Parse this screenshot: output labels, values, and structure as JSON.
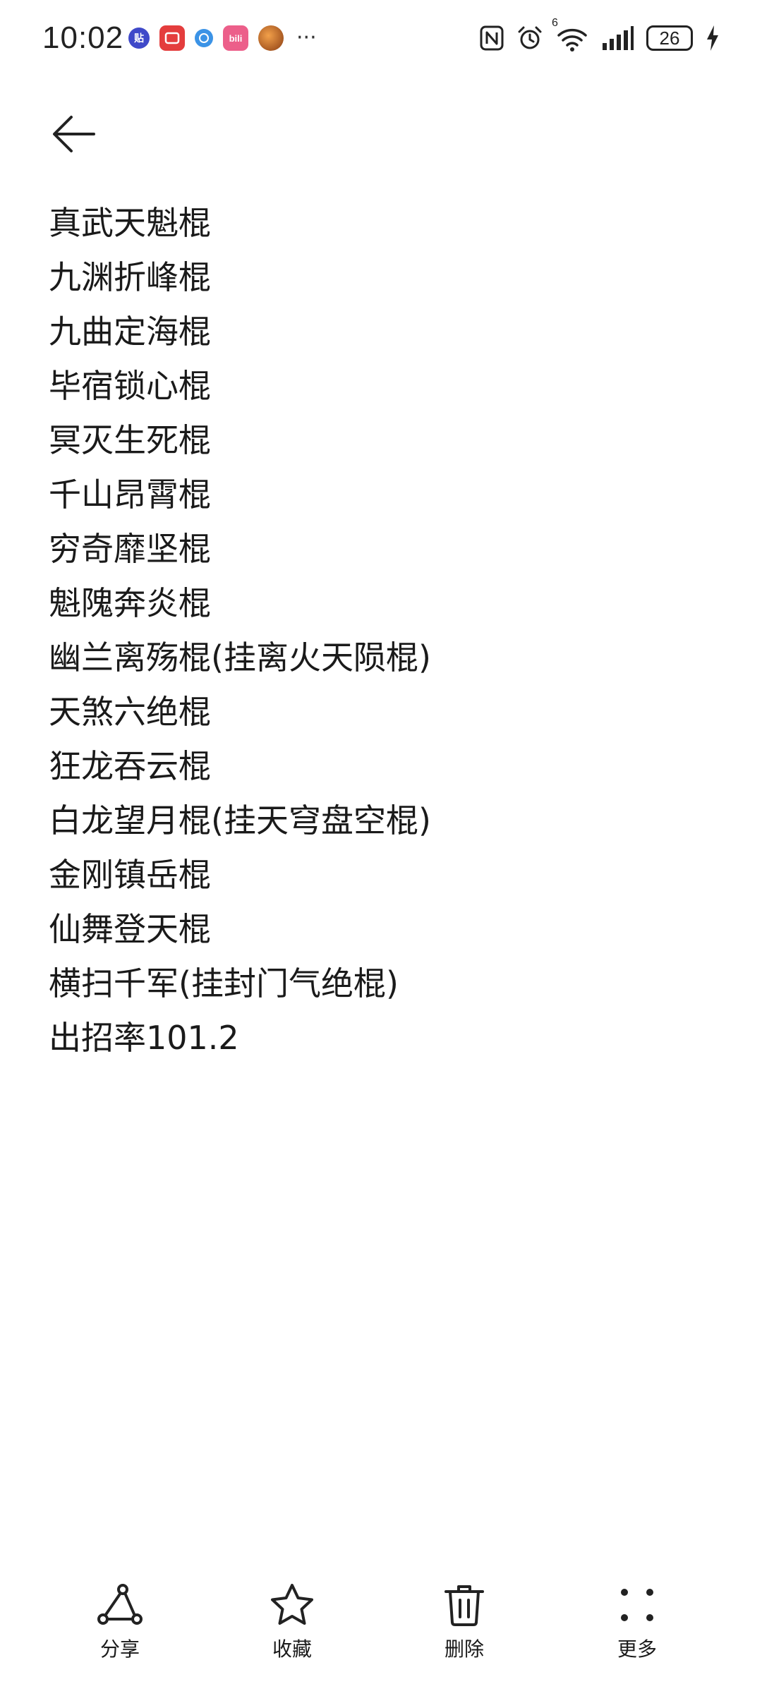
{
  "status_bar": {
    "time": "10:02",
    "notifications": [
      {
        "name": "tieba-icon",
        "glyph": "贴"
      },
      {
        "name": "red-app-icon",
        "glyph": ""
      },
      {
        "name": "browser-icon",
        "glyph": ""
      },
      {
        "name": "bilibili-icon",
        "glyph": "bili"
      },
      {
        "name": "avatar-icon",
        "glyph": ""
      }
    ],
    "more_indicator": "···",
    "network_label": "6",
    "battery_level": "26"
  },
  "note": {
    "lines": [
      "真武天魁棍",
      "九渊折峰棍",
      "九曲定海棍",
      "毕宿锁心棍",
      "冥灭生死棍",
      "千山昂霄棍",
      "穷奇靡坚棍",
      "魁隗奔炎棍",
      "幽兰离殇棍(挂离火天陨棍)",
      "天煞六绝棍",
      "狂龙吞云棍",
      "白龙望月棍(挂天穹盘空棍)",
      "金刚镇岳棍",
      "仙舞登天棍",
      "横扫千军(挂封门气绝棍)",
      "出招率101.2"
    ]
  },
  "toolbar": {
    "share_label": "分享",
    "favorite_label": "收藏",
    "delete_label": "删除",
    "more_label": "更多"
  }
}
